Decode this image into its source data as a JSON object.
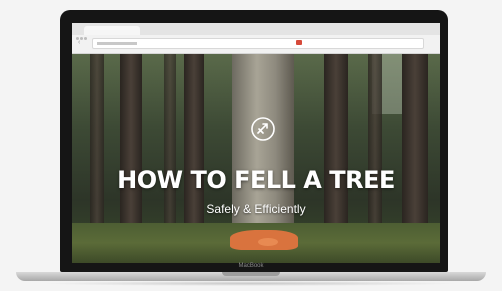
{
  "hero": {
    "title": "HOW TO FELL A TREE",
    "subtitle": "Safely & Efficiently"
  },
  "device": {
    "brand": "MacBook"
  },
  "icons": {
    "logo": "tree-axe-logo-icon",
    "record": "record-indicator-icon",
    "back": "back-arrow-icon"
  },
  "colors": {
    "title": "#ffffff",
    "stump_cut": "#d9733e",
    "record": "#d64a3a"
  }
}
